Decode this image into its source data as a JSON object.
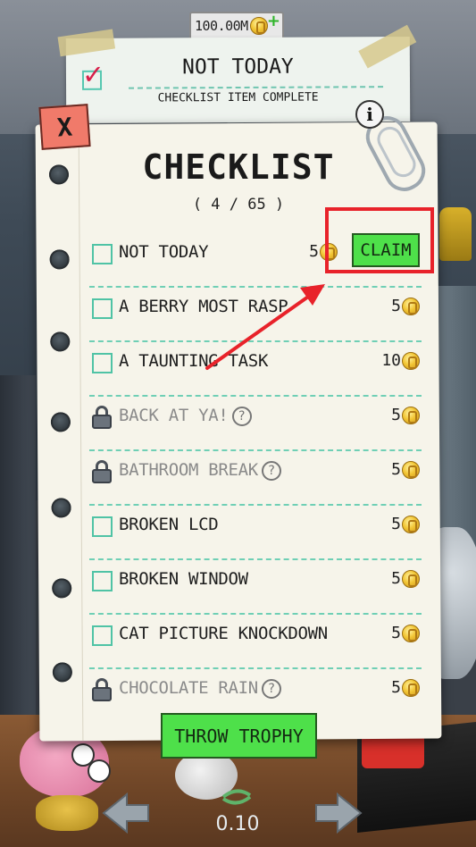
{
  "currency": {
    "amount": "100.00M"
  },
  "notification": {
    "title": "NOT TODAY",
    "subtitle": "CHECKLIST ITEM COMPLETE"
  },
  "checklist": {
    "close_label": "X",
    "info_label": "i",
    "title": "CHECKLIST",
    "progress": "( 4 / 65 )",
    "claim_label": "CLAIM",
    "items": [
      {
        "name": "NOT TODAY",
        "reward": "5",
        "locked": false,
        "claimable": true
      },
      {
        "name": "A BERRY MOST RASP",
        "reward": "5",
        "locked": false
      },
      {
        "name": "A TAUNTING TASK",
        "reward": "10",
        "locked": false
      },
      {
        "name": "BACK AT YA!",
        "reward": "5",
        "locked": true
      },
      {
        "name": "BATHROOM BREAK",
        "reward": "5",
        "locked": true
      },
      {
        "name": "BROKEN LCD",
        "reward": "5",
        "locked": false
      },
      {
        "name": "BROKEN WINDOW",
        "reward": "5",
        "locked": false
      },
      {
        "name": "CAT PICTURE KNOCKDOWN",
        "reward": "5",
        "locked": false
      },
      {
        "name": "CHOCOLATE RAIN",
        "reward": "5",
        "locked": true
      }
    ],
    "throw_trophy_label": "THROW TROPHY"
  },
  "bottom": {
    "value": "0.10"
  },
  "colors": {
    "accent_green": "#4ee04a",
    "highlight_red": "#e8222a",
    "dash_teal": "#6fcfb5",
    "close_red": "#f07a6a"
  }
}
